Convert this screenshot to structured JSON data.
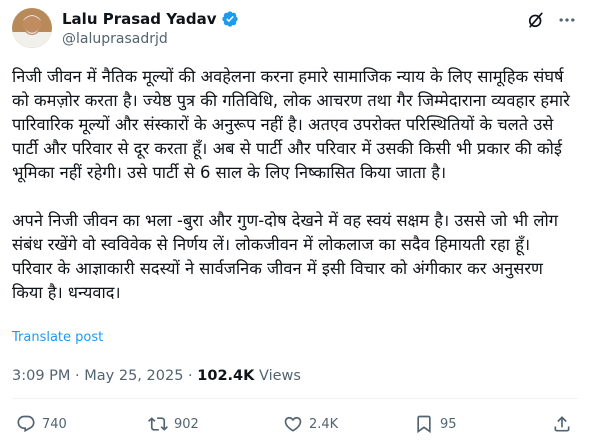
{
  "author": {
    "name": "Lalu Prasad Yadav",
    "handle": "@laluprasadrjd",
    "verified": true,
    "verified_color": "#1d9bf0"
  },
  "header_icons": [
    "grok-icon",
    "more-icon"
  ],
  "tweet": {
    "paragraphs": [
      "निजी जीवन में नैतिक मूल्यों की अवहेलना करना हमारे सामाजिक न्याय के लिए सामूहिक संघर्ष को कमज़ोर करता है। ज्येष्ठ पुत्र की गतिविधि, लोक आचरण तथा गैर जिम्मेदाराना व्यवहार हमारे पारिवारिक मूल्यों और संस्कारों के अनुरूप नहीं है। अतएव उपरोक्त परिस्थितियों के चलते उसे पार्टी और परिवार से दूर करता हूँ। अब से पार्टी और परिवार में उसकी किसी भी प्रकार की कोई भूमिका नहीं रहेगी। उसे पार्टी से 6 साल के लिए निष्कासित किया जाता है।",
      "अपने निजी जीवन का भला -बुरा और गुण-दोष देखने में वह स्वयं सक्षम है। उससे जो भी लोग संबंध रखेंगे वो स्वविवेक से निर्णय लें। लोकजीवन में लोकलाज का सदैव हिमायती रहा हूँ। परिवार के आज्ञाकारी सदस्यों ने सार्वजनिक जीवन में इसी विचार को अंगीकार कर अनुसरण किया है। धन्यवाद।"
    ],
    "translate_label": "Translate post",
    "translate_color": "#1d9bf0"
  },
  "meta": {
    "time": "3:09 PM",
    "separator": "·",
    "date": "May 25, 2025",
    "views_count": "102.4K",
    "views_label": "Views"
  },
  "actions": {
    "replies": "740",
    "reposts": "902",
    "likes": "2.4K",
    "bookmarks": "95"
  },
  "colors": {
    "text": "#0f1419",
    "secondary": "#536471",
    "accent": "#1d9bf0"
  }
}
